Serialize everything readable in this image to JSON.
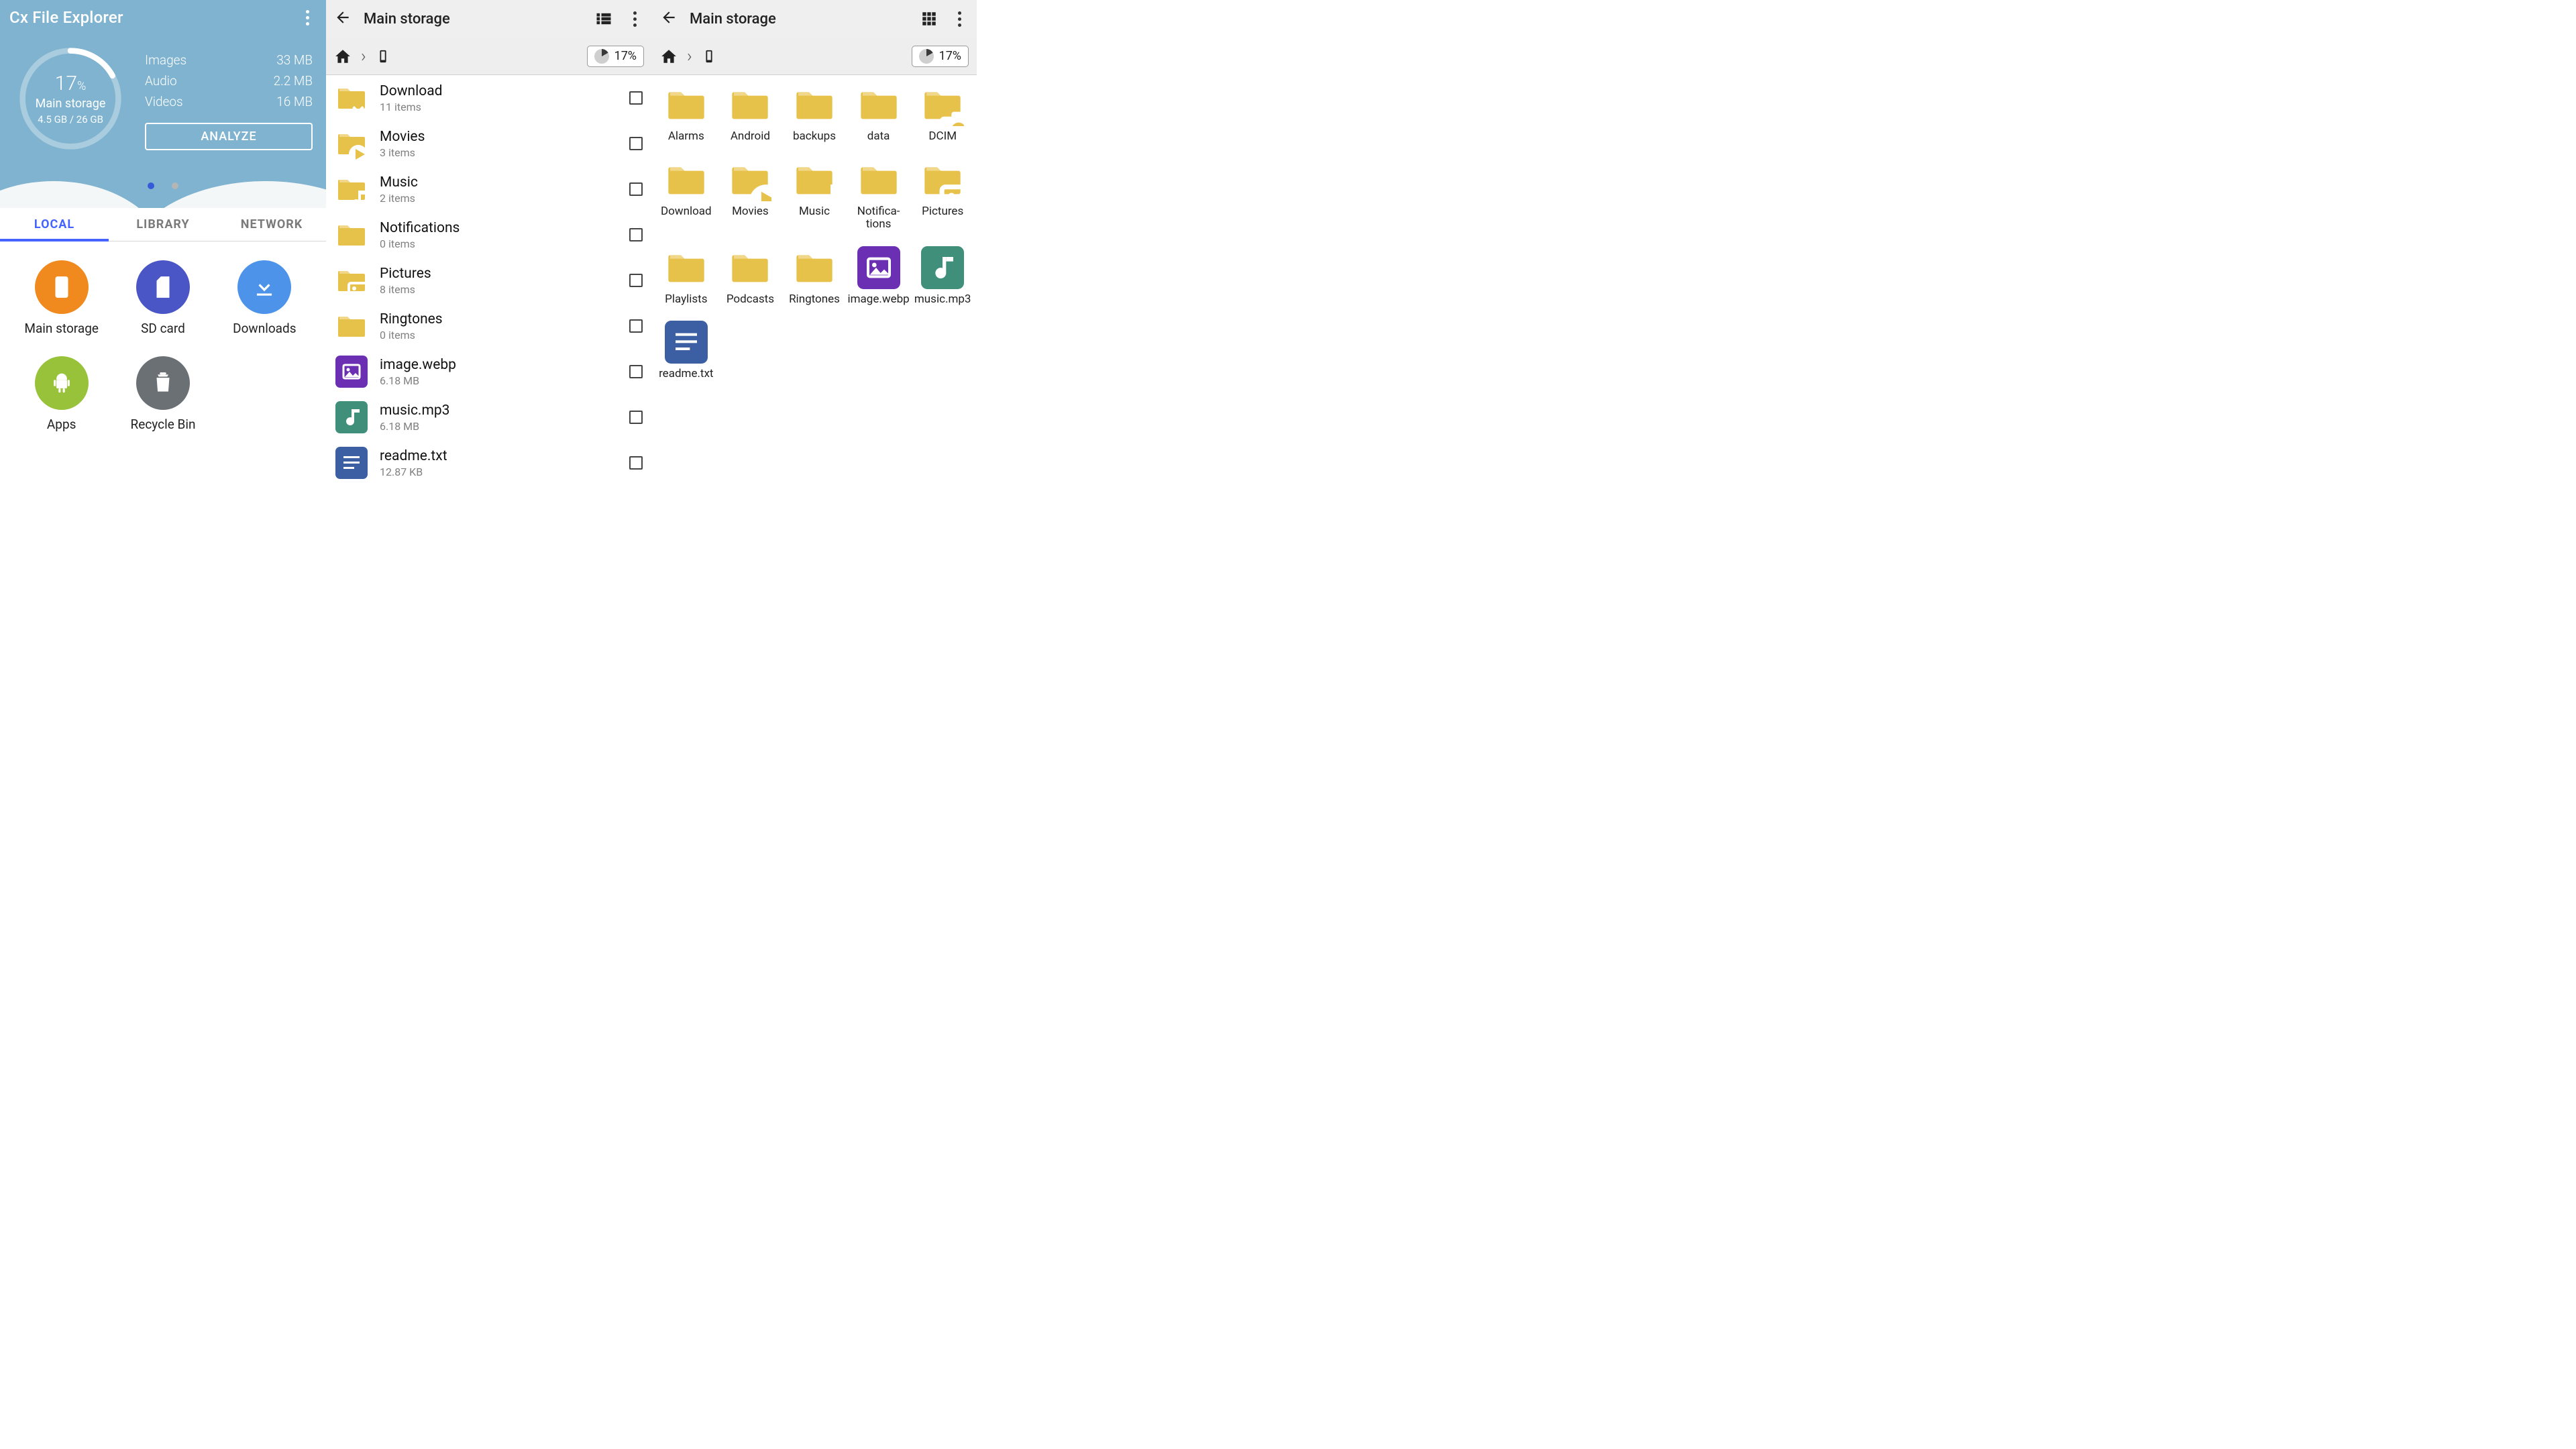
{
  "colors": {
    "hero": "#7fb3cf",
    "accent": "#4563ff",
    "folder": "#e7c24a",
    "img_tile": "#6b2fb3",
    "audio_tile": "#3f8f7a",
    "doc_tile": "#3c5fa4",
    "loc_orange": "#f08a1e",
    "loc_indigo": "#4a56c6",
    "loc_blue": "#4d93ea",
    "loc_green": "#97c23a",
    "loc_grey": "#6b7074"
  },
  "pane1": {
    "title": "Cx File Explorer",
    "ring": {
      "percent": "17",
      "pct_suffix": "%",
      "name": "Main storage",
      "used": "4.5 GB / 26 GB"
    },
    "media": [
      {
        "label": "Images",
        "value": "33 MB"
      },
      {
        "label": "Audio",
        "value": "2.2 MB"
      },
      {
        "label": "Videos",
        "value": "16 MB"
      }
    ],
    "analyze": "ANALYZE",
    "tabs": [
      "LOCAL",
      "LIBRARY",
      "NETWORK"
    ],
    "locations": [
      {
        "label": "Main storage",
        "icon": "phone",
        "color": "loc_orange"
      },
      {
        "label": "SD card",
        "icon": "sdcard",
        "color": "loc_indigo"
      },
      {
        "label": "Downloads",
        "icon": "download",
        "color": "loc_blue"
      },
      {
        "label": "Apps",
        "icon": "android",
        "color": "loc_green"
      },
      {
        "label": "Recycle Bin",
        "icon": "trash",
        "color": "loc_grey"
      }
    ]
  },
  "pane2": {
    "title": "Main storage",
    "percent": "17%",
    "items": [
      {
        "name": "Download",
        "sub": "11 items",
        "kind": "folder",
        "glyph": "download"
      },
      {
        "name": "Movies",
        "sub": "3 items",
        "kind": "folder",
        "glyph": "play"
      },
      {
        "name": "Music",
        "sub": "2 items",
        "kind": "folder",
        "glyph": "note"
      },
      {
        "name": "Notifications",
        "sub": "0 items",
        "kind": "folder",
        "glyph": ""
      },
      {
        "name": "Pictures",
        "sub": "8 items",
        "kind": "folder",
        "glyph": "image"
      },
      {
        "name": "Ringtones",
        "sub": "0 items",
        "kind": "folder",
        "glyph": ""
      },
      {
        "name": "image.webp",
        "sub": "6.18 MB",
        "kind": "image"
      },
      {
        "name": "music.mp3",
        "sub": "6.18 MB",
        "kind": "audio"
      },
      {
        "name": "readme.txt",
        "sub": "12.87 KB",
        "kind": "doc"
      }
    ]
  },
  "pane3": {
    "title": "Main storage",
    "percent": "17%",
    "items": [
      {
        "name": "Alarms",
        "kind": "folder",
        "glyph": ""
      },
      {
        "name": "Android",
        "kind": "folder",
        "glyph": ""
      },
      {
        "name": "backups",
        "kind": "folder",
        "glyph": ""
      },
      {
        "name": "data",
        "kind": "folder",
        "glyph": ""
      },
      {
        "name": "DCIM",
        "kind": "folder",
        "glyph": "camera"
      },
      {
        "name": "Download",
        "kind": "folder",
        "glyph": "download"
      },
      {
        "name": "Movies",
        "kind": "folder",
        "glyph": "play"
      },
      {
        "name": "Music",
        "kind": "folder",
        "glyph": "note"
      },
      {
        "name": "Notifica­tions",
        "kind": "folder",
        "glyph": ""
      },
      {
        "name": "Pictures",
        "kind": "folder",
        "glyph": "image"
      },
      {
        "name": "Playlists",
        "kind": "folder",
        "glyph": ""
      },
      {
        "name": "Podcasts",
        "kind": "folder",
        "glyph": ""
      },
      {
        "name": "Ringtones",
        "kind": "folder",
        "glyph": ""
      },
      {
        "name": "image.webp",
        "kind": "image"
      },
      {
        "name": "music.mp3",
        "kind": "audio"
      },
      {
        "name": "readme.txt",
        "kind": "doc"
      }
    ]
  }
}
